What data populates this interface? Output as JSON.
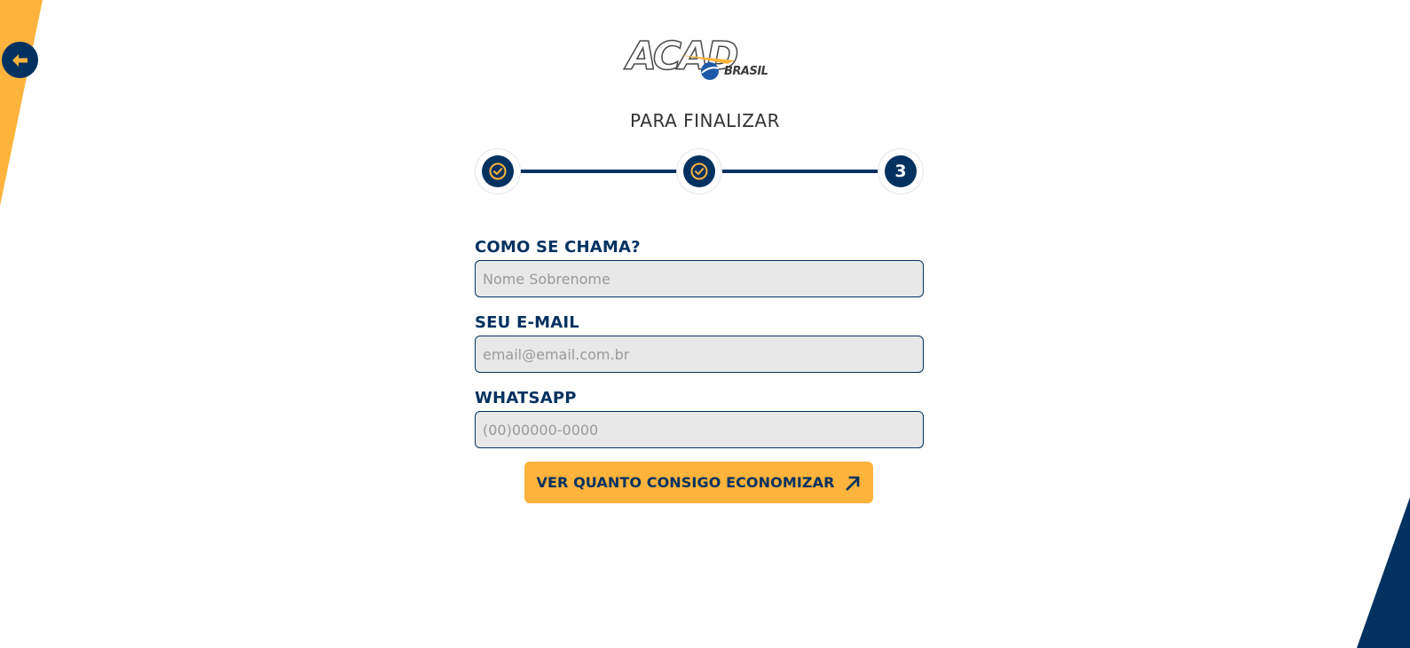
{
  "colors": {
    "navy": "#033260",
    "orange": "#fdb33c",
    "input_bg": "#e8e8e8"
  },
  "nav": {
    "back_icon": "arrow-left-icon"
  },
  "logo": {
    "main": "ACAD",
    "sub": "BRASIL"
  },
  "page": {
    "title": "PARA FINALIZAR"
  },
  "stepper": {
    "steps": [
      {
        "state": "done",
        "icon": "check-circle-icon"
      },
      {
        "state": "done",
        "icon": "check-circle-icon"
      },
      {
        "state": "current",
        "label": "3"
      }
    ]
  },
  "form": {
    "name": {
      "label": "COMO SE CHAMA?",
      "placeholder": "Nome Sobrenome",
      "value": ""
    },
    "email": {
      "label": "SEU E-MAIL",
      "placeholder": "email@email.com.br",
      "value": ""
    },
    "whatsapp": {
      "label": "WHATSAPP",
      "placeholder": "(00)00000-0000",
      "value": ""
    },
    "submit": {
      "label": "VER QUANTO CONSIGO ECONOMIZAR",
      "icon": "arrow-up-right-icon"
    }
  }
}
